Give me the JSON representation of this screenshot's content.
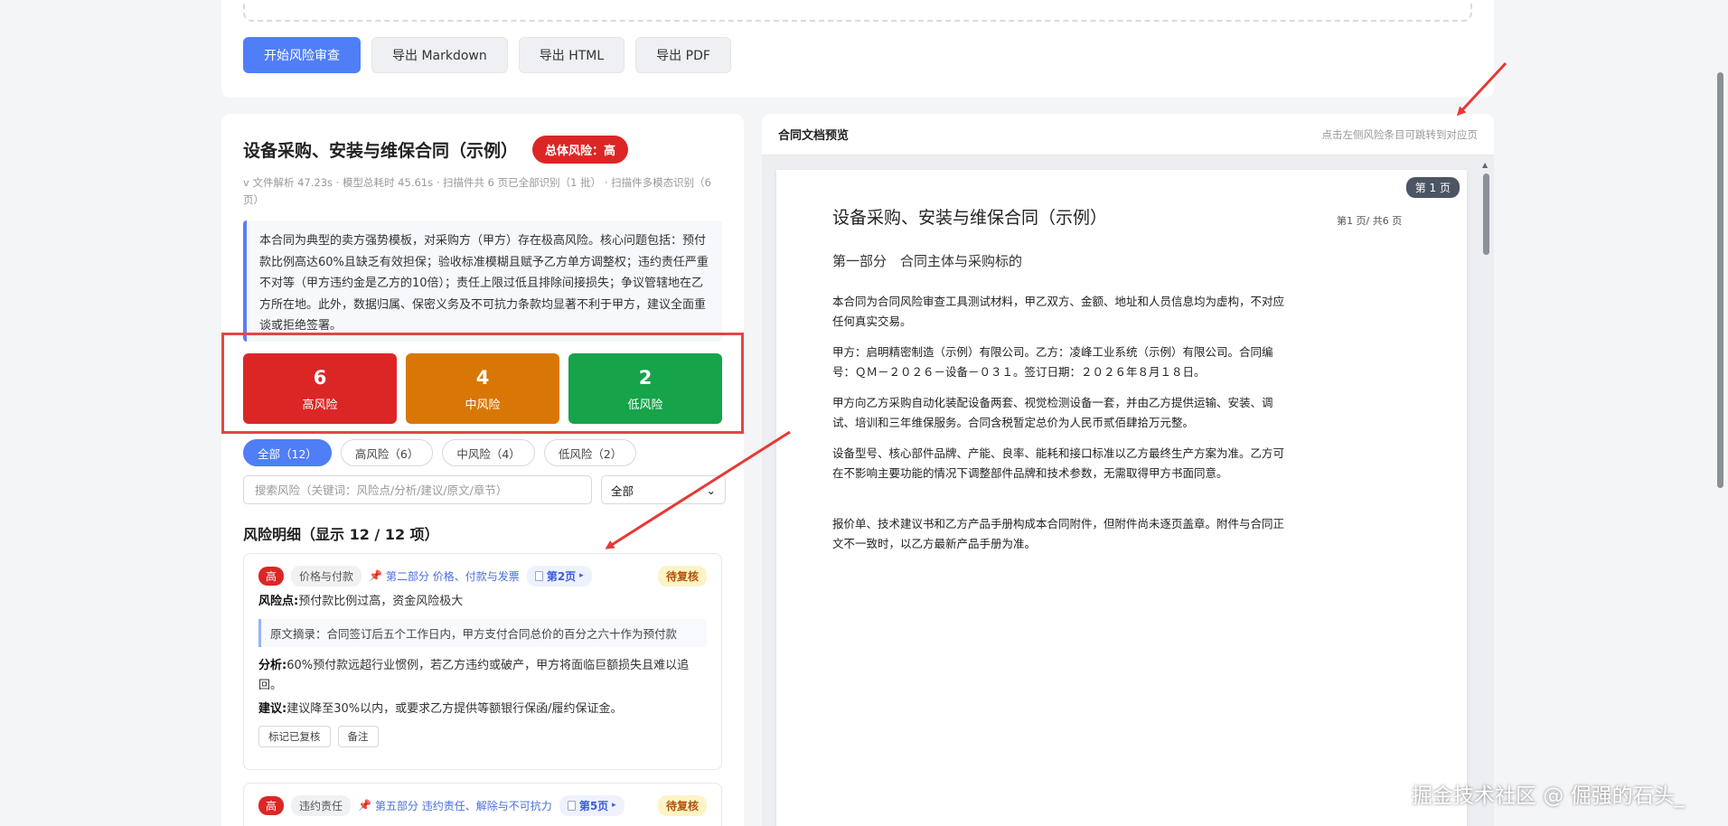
{
  "toolbar": {
    "start_label": "开始风险审查",
    "export_md": "导出 Markdown",
    "export_html": "导出 HTML",
    "export_pdf": "导出 PDF"
  },
  "doc": {
    "title": "设备采购、安装与维保合同（示例）",
    "overall_risk": "总体风险：高",
    "meta": "v 文件解析 47.23s · 模型总耗时 45.61s · 扫描件共 6 页已全部识别（1 批） · 扫描件多模态识别（6页）",
    "summary": "本合同为典型的卖方强势模板，对采购方（甲方）存在极高风险。核心问题包括：预付款比例高达60%且缺乏有效担保；验收标准模糊且赋予乙方单方调整权；违约责任严重不对等（甲方违约金是乙方的10倍）；责任上限过低且排除间接损失；争议管辖地在乙方所在地。此外，数据归属、保密义务及不可抗力条款均显著不利于甲方，建议全面重谈或拒绝签署。"
  },
  "stats": {
    "high": {
      "count": "6",
      "label": "高风险"
    },
    "mid": {
      "count": "4",
      "label": "中风险"
    },
    "low": {
      "count": "2",
      "label": "低风险"
    }
  },
  "filters": {
    "all": "全部（12）",
    "high": "高风险（6）",
    "mid": "中风险（4）",
    "low": "低风险（2）",
    "search_placeholder": "搜索风险（关键词：风险点/分析/建议/原文/章节）",
    "select_value": "全部"
  },
  "list": {
    "title": "风险明细（显示 12 / 12 项）",
    "items": [
      {
        "level": "高",
        "category": "价格与付款",
        "section": "第二部分 价格、付款与发票",
        "page": "第2页",
        "status": "待复核",
        "point_label": "风险点:",
        "point": "预付款比例过高，资金风险极大",
        "excerpt": "原文摘录：合同签订后五个工作日内，甲方支付合同总价的百分之六十作为预付款",
        "analysis_label": "分析:",
        "analysis": "60%预付款远超行业惯例，若乙方违约或破产，甲方将面临巨额损失且难以追回。",
        "advice_label": "建议:",
        "advice": "建议降至30%以内，或要求乙方提供等额银行保函/履约保证金。",
        "mark_btn": "标记已复核",
        "note_btn": "备注"
      },
      {
        "level": "高",
        "category": "违约责任",
        "section": "第五部分 违约责任、解除与不可抗力",
        "page": "第5页",
        "status": "待复核"
      }
    ]
  },
  "preview": {
    "title": "合同文档预览",
    "hint": "点击左侧风险条目可跳转到对应页",
    "page_badge": "第 1 页",
    "page_title": "设备采购、安装与维保合同（示例）",
    "page_number": "第1 页/ 共6 页",
    "part": "第一部分　合同主体与采购标的",
    "paragraphs": [
      "本合同为合同风险审查工具测试材料，甲乙双方、金额、地址和人员信息均为虚构，不对应任何真实交易。",
      "甲方：启明精密制造（示例）有限公司。乙方：凌峰工业系统（示例）有限公司。合同编号：ＱＭ－２０２６－设备－０３１。签订日期：２０２６年８月１８日。",
      "甲方向乙方采购自动化装配设备两套、视觉检测设备一套，并由乙方提供运输、安装、调试、培训和三年维保服务。合同含税暂定总价为人民币贰佰肆拾万元整。",
      "设备型号、核心部件品牌、产能、良率、能耗和接口标准以乙方最终生产方案为准。乙方可在不影响主要功能的情况下调整部件品牌和技术参数，无需取得甲方书面同意。",
      "报价单、技术建议书和乙方产品手册构成本合同附件，但附件尚未逐页盖章。附件与合同正文不一致时，以乙方最新产品手册为准。"
    ]
  },
  "watermark": "掘金技术社区 @ 倔强的石头_"
}
